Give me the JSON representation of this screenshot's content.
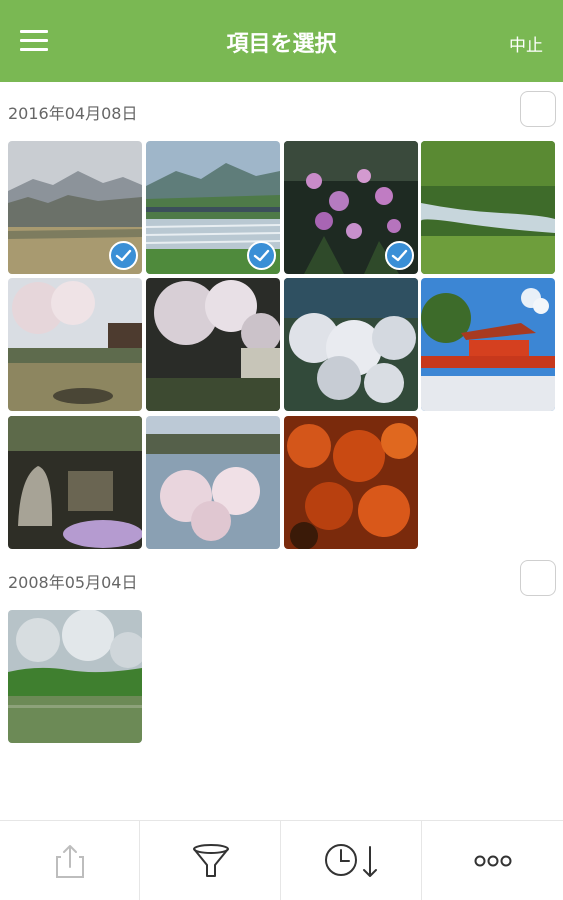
{
  "header": {
    "title": "項目を選択",
    "cancel_label": "中止",
    "background_color": "#7ab853"
  },
  "sections": [
    {
      "date": "2016年04月08日",
      "photos": [
        {
          "name": "misty-mountains",
          "selected": true
        },
        {
          "name": "river-with-bridge",
          "selected": true
        },
        {
          "name": "pink-azalea-flowers",
          "selected": true
        },
        {
          "name": "mossy-stream",
          "selected": false
        },
        {
          "name": "cherry-blossom-garden",
          "selected": false
        },
        {
          "name": "cherry-blossom-house",
          "selected": false
        },
        {
          "name": "white-blossom-trees",
          "selected": false
        },
        {
          "name": "red-shrine-gate",
          "selected": false
        },
        {
          "name": "stone-garden",
          "selected": false
        },
        {
          "name": "blossoms-over-pond",
          "selected": false
        },
        {
          "name": "autumn-red-leaves",
          "selected": false
        }
      ]
    },
    {
      "date": "2008年05月04日",
      "photos": [
        {
          "name": "green-lake",
          "selected": false
        }
      ]
    }
  ],
  "toolbar": {
    "icons": [
      "share-icon",
      "filter-icon",
      "sort-by-time-icon",
      "more-icon"
    ]
  },
  "colors": {
    "accent": "#7ab853",
    "selected_badge": "#3a8fd6"
  }
}
